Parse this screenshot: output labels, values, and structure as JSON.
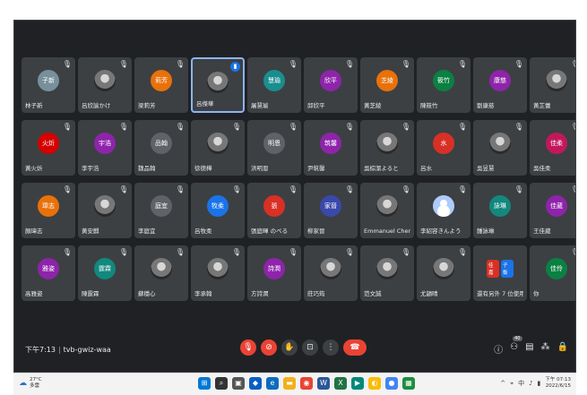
{
  "meeting": {
    "time": "下午7:13",
    "code": "tvb-gwiz-waa"
  },
  "participants": [
    {
      "name": "林子新",
      "avatar": "子新",
      "color": "#78909c",
      "type": "initials",
      "muted": true
    },
    {
      "name": "呂欣諭かけ",
      "avatar": "",
      "type": "photo",
      "muted": true
    },
    {
      "name": "梁莉芳",
      "avatar": "莉芳",
      "color": "#e8710a",
      "type": "initials",
      "muted": true
    },
    {
      "name": "呂傑華",
      "avatar": "",
      "type": "photo",
      "muted": false,
      "active": true
    },
    {
      "name": "屠慧瑜",
      "avatar": "慧瑜",
      "color": "#1a8e8e",
      "type": "initials",
      "muted": true
    },
    {
      "name": "邱欣平",
      "avatar": "欣平",
      "color": "#8e24aa",
      "type": "initials",
      "muted": true
    },
    {
      "name": "黃芝綾",
      "avatar": "芝綾",
      "color": "#e8710a",
      "type": "initials",
      "muted": true
    },
    {
      "name": "陳筱竹",
      "avatar": "筱竹",
      "color": "#0b8043",
      "type": "initials",
      "muted": true
    },
    {
      "name": "劉康慈",
      "avatar": "康慈",
      "color": "#8e24aa",
      "type": "initials",
      "muted": true
    },
    {
      "name": "黃芷蕾",
      "avatar": "",
      "type": "photo",
      "muted": true
    },
    {
      "name": "黃火炘",
      "avatar": "火炘",
      "color": "#d50000",
      "type": "initials",
      "muted": true
    },
    {
      "name": "李宇浩",
      "avatar": "宇浩",
      "color": "#8e24aa",
      "type": "initials",
      "muted": true
    },
    {
      "name": "魏品翰",
      "avatar": "品翰",
      "color": "#5f6368",
      "type": "initials",
      "muted": true
    },
    {
      "name": "徐德樺",
      "avatar": "",
      "type": "photo",
      "muted": true
    },
    {
      "name": "洪明恩",
      "avatar": "明恩",
      "color": "#5f6368",
      "type": "initials",
      "muted": true
    },
    {
      "name": "尹筑馨",
      "avatar": "筑馨",
      "color": "#8e24aa",
      "type": "initials",
      "muted": true
    },
    {
      "name": "吳棕潔よると",
      "avatar": "",
      "type": "photo",
      "muted": true
    },
    {
      "name": "呂水",
      "avatar": "水",
      "color": "#d93025",
      "type": "initials",
      "muted": true
    },
    {
      "name": "吳昱慧",
      "avatar": "",
      "type": "photo",
      "muted": true
    },
    {
      "name": "吳佳柔",
      "avatar": "佳柔",
      "color": "#c2185b",
      "type": "initials",
      "muted": true
    },
    {
      "name": "顏瑋志",
      "avatar": "瑋志",
      "color": "#e8710a",
      "type": "initials",
      "muted": true
    },
    {
      "name": "黃安麒",
      "avatar": "",
      "type": "photo",
      "muted": true
    },
    {
      "name": "李庭宜",
      "avatar": "庭宜",
      "color": "#5f6368",
      "type": "initials",
      "muted": true
    },
    {
      "name": "呂牧柔",
      "avatar": "牧柔",
      "color": "#1a73e8",
      "type": "initials",
      "muted": true
    },
    {
      "name": "張庭暉 のべる",
      "avatar": "張",
      "color": "#d93025",
      "type": "initials",
      "muted": true
    },
    {
      "name": "柳家晉",
      "avatar": "家晉",
      "color": "#3949ab",
      "type": "initials",
      "muted": true
    },
    {
      "name": "Emmanuel Chen",
      "avatar": "",
      "type": "photo",
      "muted": true
    },
    {
      "name": "李紹容きんよう",
      "avatar": "",
      "type": "anon",
      "muted": true
    },
    {
      "name": "鍾詠琳",
      "avatar": "詠琳",
      "color": "#12887e",
      "type": "initials",
      "muted": true
    },
    {
      "name": "王佳葳",
      "avatar": "佳葳",
      "color": "#8e24aa",
      "type": "initials",
      "muted": true
    },
    {
      "name": "高雅姿",
      "avatar": "雅姿",
      "color": "#8e24aa",
      "type": "initials",
      "muted": true
    },
    {
      "name": "陳霆霖",
      "avatar": "霆霖",
      "color": "#12887e",
      "type": "initials",
      "muted": true
    },
    {
      "name": "蘇穩心",
      "avatar": "",
      "type": "photo",
      "muted": true
    },
    {
      "name": "李承翰",
      "avatar": "",
      "type": "photo",
      "muted": true
    },
    {
      "name": "方詩潤",
      "avatar": "詩潤",
      "color": "#8e24aa",
      "type": "initials",
      "muted": true
    },
    {
      "name": "莊巧筠",
      "avatar": "",
      "type": "photo",
      "muted": true
    },
    {
      "name": "范文誠",
      "avatar": "",
      "type": "photo",
      "muted": true
    },
    {
      "name": "尤韻晴",
      "avatar": "",
      "type": "photo",
      "muted": true
    },
    {
      "name": "還有另外 7 位使用者",
      "avatar": "",
      "type": "group",
      "muted": false,
      "group_avatars": [
        {
          "label": "佳嘉",
          "color": "#d93025"
        },
        {
          "label": "子衡",
          "color": "#1a73e8"
        }
      ]
    },
    {
      "name": "你",
      "avatar": "佳伶",
      "color": "#0b8043",
      "type": "initials",
      "muted": true
    }
  ],
  "controls": {
    "mic_icon": "mic-off-icon",
    "cam_icon": "camera-off-icon",
    "hand_icon": "raise-hand-icon",
    "present_icon": "present-icon",
    "more_icon": "more-icon",
    "leave_icon": "end-call-icon"
  },
  "right_controls": {
    "people_count": "40"
  },
  "taskbar": {
    "temp": "27°C",
    "weather": "多雲",
    "clock_time": "下午 07:13",
    "clock_date": "2022/6/15"
  }
}
